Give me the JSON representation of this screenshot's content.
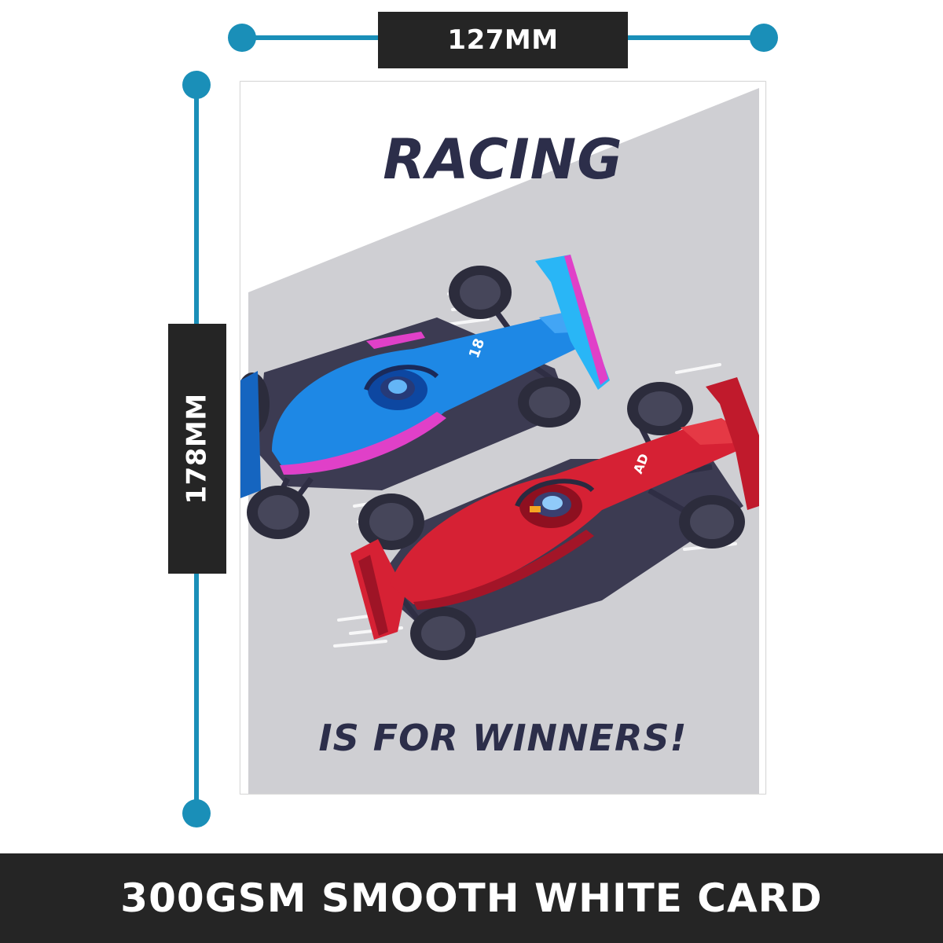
{
  "dimensions": {
    "width_label": "127MM",
    "height_label": "178MM"
  },
  "card": {
    "title": "RACING",
    "subtitle": "IS FOR WINNERS!",
    "blue_car_number": "18",
    "red_car_number": "AD"
  },
  "footer": {
    "text": "300GSM SMOOTH WHITE CARD"
  },
  "colors": {
    "accent": "#1a8fb8",
    "label_bg": "#252525",
    "text_dark": "#2c2e4a",
    "band_grey": "#cfcfd3",
    "blue_car": "#1e88e5",
    "red_car": "#d62134"
  }
}
